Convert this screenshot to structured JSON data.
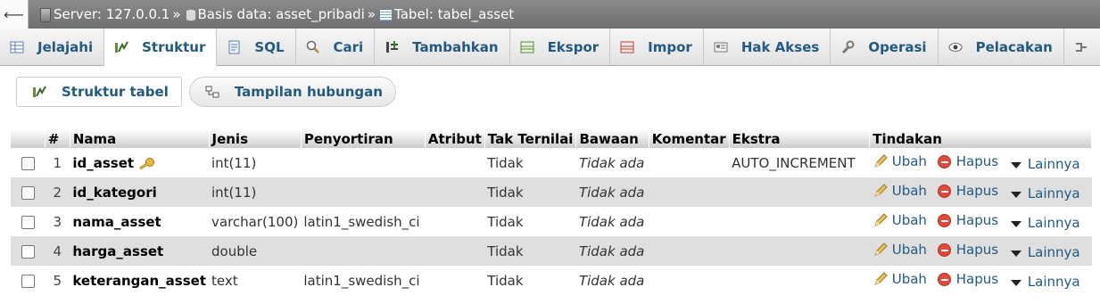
{
  "breadcrumb": {
    "server": "Server: 127.0.0.1",
    "database": "Basis data: asset_pribadi",
    "table": "Tabel: tabel_asset",
    "separator": "»"
  },
  "tabs": [
    {
      "label": "Jelajahi",
      "icon": "browse-icon",
      "active": false
    },
    {
      "label": "Struktur",
      "icon": "structure-icon",
      "active": true
    },
    {
      "label": "SQL",
      "icon": "sql-icon",
      "active": false
    },
    {
      "label": "Cari",
      "icon": "search-icon",
      "active": false
    },
    {
      "label": "Tambahkan",
      "icon": "insert-icon",
      "active": false
    },
    {
      "label": "Ekspor",
      "icon": "export-icon",
      "active": false
    },
    {
      "label": "Impor",
      "icon": "import-icon",
      "active": false
    },
    {
      "label": "Hak Akses",
      "icon": "privileges-icon",
      "active": false
    },
    {
      "label": "Operasi",
      "icon": "wrench-icon",
      "active": false
    },
    {
      "label": "Pelacakan",
      "icon": "eye-icon",
      "active": false
    }
  ],
  "subnav": {
    "structure_table": "Struktur tabel",
    "relation_view": "Tampilan hubungan"
  },
  "columns": [
    "#",
    "Nama",
    "Jenis",
    "Penyortiran",
    "Atribut",
    "Tak Ternilai",
    "Bawaan",
    "Komentar",
    "Ekstra",
    "Tindakan"
  ],
  "rows": [
    {
      "num": "1",
      "name": "id_asset",
      "primary": true,
      "type": "int(11)",
      "collation": "",
      "attributes": "",
      "null": "Tidak",
      "default": "Tidak ada",
      "comment": "",
      "extra": "AUTO_INCREMENT"
    },
    {
      "num": "2",
      "name": "id_kategori",
      "primary": false,
      "type": "int(11)",
      "collation": "",
      "attributes": "",
      "null": "Tidak",
      "default": "Tidak ada",
      "comment": "",
      "extra": ""
    },
    {
      "num": "3",
      "name": "nama_asset",
      "primary": false,
      "type": "varchar(100)",
      "collation": "latin1_swedish_ci",
      "attributes": "",
      "null": "Tidak",
      "default": "Tidak ada",
      "comment": "",
      "extra": ""
    },
    {
      "num": "4",
      "name": "harga_asset",
      "primary": false,
      "type": "double",
      "collation": "",
      "attributes": "",
      "null": "Tidak",
      "default": "Tidak ada",
      "comment": "",
      "extra": ""
    },
    {
      "num": "5",
      "name": "keterangan_asset",
      "primary": false,
      "type": "text",
      "collation": "latin1_swedish_ci",
      "attributes": "",
      "null": "Tidak",
      "default": "Tidak ada",
      "comment": "",
      "extra": ""
    }
  ],
  "actions": {
    "edit": "Ubah",
    "delete": "Hapus",
    "more": "Lainnya"
  },
  "colors": {
    "link": "#235a81",
    "topbar": "#7d7d7d",
    "row_alt": "#dfdfdf",
    "delete_icon": "#e04a3a",
    "key_icon": "#e0b030"
  }
}
